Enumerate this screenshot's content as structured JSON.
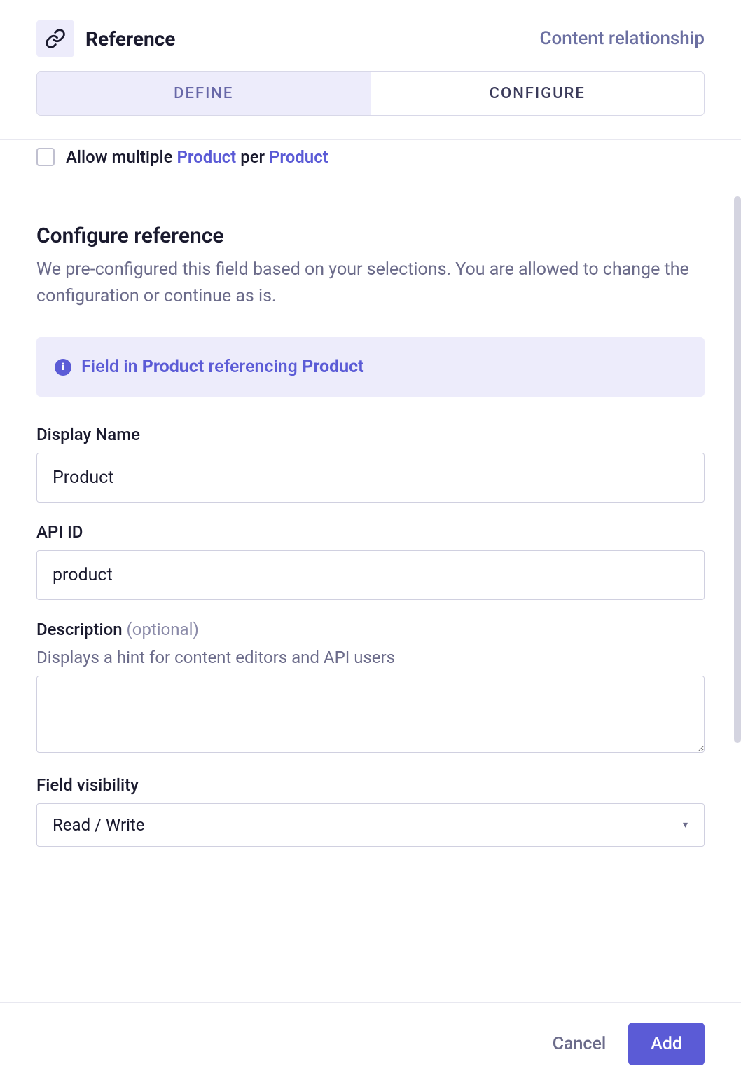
{
  "header": {
    "title": "Reference",
    "subtitle": "Content relationship"
  },
  "tabs": {
    "define": "DEFINE",
    "configure": "CONFIGURE"
  },
  "checkbox": {
    "prefix": "Allow multiple ",
    "model1": "Product",
    "mid": " per ",
    "model2": "Product"
  },
  "section": {
    "title": "Configure reference",
    "desc": "We pre-configured this field based on your selections. You are allowed to change the configuration or continue as is."
  },
  "info": {
    "prefix": "Field in ",
    "model1": "Product",
    "mid": " referencing ",
    "model2": "Product"
  },
  "fields": {
    "displayName": {
      "label": "Display Name",
      "value": "Product"
    },
    "apiId": {
      "label": "API ID",
      "value": "product"
    },
    "description": {
      "label": "Description ",
      "optional": "(optional)",
      "hint": "Displays a hint for content editors and API users",
      "value": ""
    },
    "visibility": {
      "label": "Field visibility",
      "value": "Read / Write"
    }
  },
  "footer": {
    "cancel": "Cancel",
    "add": "Add"
  }
}
